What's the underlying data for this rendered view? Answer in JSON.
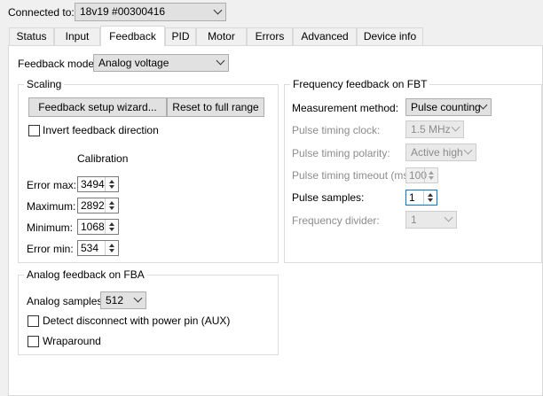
{
  "connection": {
    "label": "Connected to:",
    "device": "18v19 #00300416"
  },
  "tabs": [
    "Status",
    "Input",
    "Feedback",
    "PID",
    "Motor",
    "Errors",
    "Advanced",
    "Device info"
  ],
  "active_tab": "Feedback",
  "feedback_mode": {
    "label": "Feedback mode:",
    "value": "Analog voltage"
  },
  "scaling": {
    "title": "Scaling",
    "wizard_button": "Feedback setup wizard...",
    "reset_button": "Reset to full range",
    "invert_label": "Invert feedback direction",
    "invert_checked": false,
    "calibration_title": "Calibration",
    "rows": [
      {
        "label": "Error max:",
        "value": "3494"
      },
      {
        "label": "Maximum:",
        "value": "2892"
      },
      {
        "label": "Minimum:",
        "value": "1068"
      },
      {
        "label": "Error min:",
        "value": "534"
      }
    ]
  },
  "analog_fba": {
    "title": "Analog feedback on FBA",
    "samples_label": "Analog samples:",
    "samples_value": "512",
    "detect_label": "Detect disconnect with power pin (AUX)",
    "detect_checked": false,
    "wrap_label": "Wraparound",
    "wrap_checked": false
  },
  "freq_fbt": {
    "title": "Frequency feedback on FBT",
    "method_label": "Measurement method:",
    "method_value": "Pulse counting",
    "clock_label": "Pulse timing clock:",
    "clock_value": "1.5 MHz",
    "polarity_label": "Pulse timing polarity:",
    "polarity_value": "Active high",
    "timeout_label": "Pulse timing timeout (ms):",
    "timeout_value": "100",
    "samples_label": "Pulse samples:",
    "samples_value": "1",
    "divider_label": "Frequency divider:",
    "divider_value": "1"
  },
  "colors": {
    "focus": "#0078d7",
    "disabled_text": "#8c8c8c",
    "panel": "#ffffff",
    "window": "#f0f0f0"
  }
}
